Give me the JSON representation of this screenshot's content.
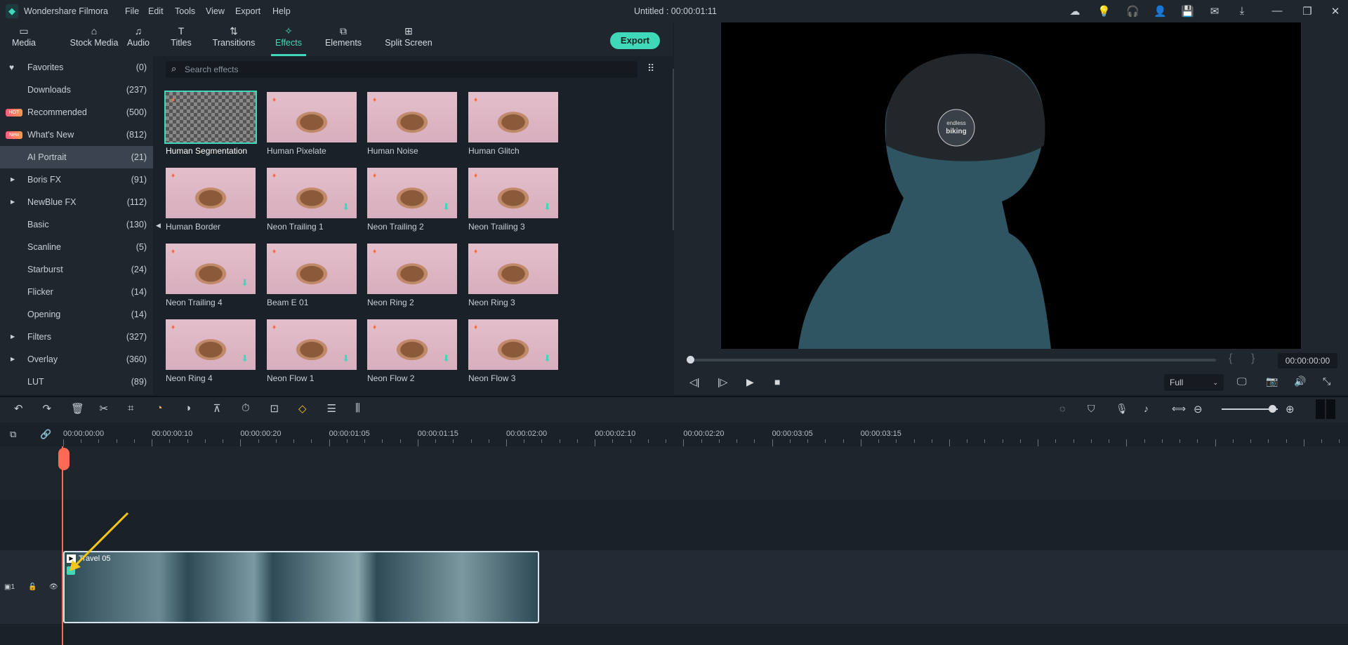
{
  "app": {
    "name": "Wondershare Filmora",
    "title": "Untitled : 00:00:01:11"
  },
  "menu": [
    "File",
    "Edit",
    "Tools",
    "View",
    "Export",
    "Help"
  ],
  "title_icons": [
    "cloud-icon",
    "bulb-icon",
    "headset-icon",
    "account-icon",
    "save-icon",
    "mail-icon",
    "download-icon",
    "minimize-icon",
    "restore-icon",
    "close-icon"
  ],
  "tabs": [
    {
      "label": "Media",
      "icon": "folder-icon"
    },
    {
      "label": "Stock Media",
      "icon": "stock-icon"
    },
    {
      "label": "Audio",
      "icon": "music-icon"
    },
    {
      "label": "Titles",
      "icon": "text-icon"
    },
    {
      "label": "Transitions",
      "icon": "transition-icon"
    },
    {
      "label": "Effects",
      "icon": "effects-icon",
      "active": true
    },
    {
      "label": "Elements",
      "icon": "elements-icon"
    },
    {
      "label": "Split Screen",
      "icon": "split-screen-icon"
    }
  ],
  "export_label": "Export",
  "sidebar": [
    {
      "label": "Favorites",
      "count": "(0)",
      "icon": "heart"
    },
    {
      "label": "Downloads",
      "count": "(237)"
    },
    {
      "label": "Recommended",
      "count": "(500)",
      "badge": "HOT"
    },
    {
      "label": "What's New",
      "count": "(812)",
      "badge": "New"
    },
    {
      "label": "AI Portrait",
      "count": "(21)",
      "selected": true
    },
    {
      "label": "Boris FX",
      "count": "(91)",
      "expandable": true
    },
    {
      "label": "NewBlue FX",
      "count": "(112)",
      "expandable": true
    },
    {
      "label": "Basic",
      "count": "(130)"
    },
    {
      "label": "Scanline",
      "count": "(5)"
    },
    {
      "label": "Starburst",
      "count": "(24)"
    },
    {
      "label": "Flicker",
      "count": "(14)"
    },
    {
      "label": "Opening",
      "count": "(14)"
    },
    {
      "label": "Filters",
      "count": "(327)",
      "expandable": true
    },
    {
      "label": "Overlay",
      "count": "(360)",
      "expandable": true
    },
    {
      "label": "LUT",
      "count": "(89)"
    }
  ],
  "search": {
    "placeholder": "Search effects"
  },
  "effects": [
    {
      "name": "Human Segmentation",
      "selected": true
    },
    {
      "name": "Human Pixelate"
    },
    {
      "name": "Human Noise"
    },
    {
      "name": "Human Glitch"
    },
    {
      "name": "Human Border"
    },
    {
      "name": "Neon Trailing 1",
      "download": true
    },
    {
      "name": "Neon Trailing 2",
      "download": true
    },
    {
      "name": "Neon Trailing 3",
      "download": true
    },
    {
      "name": "Neon Trailing 4",
      "download": true
    },
    {
      "name": "Beam E 01"
    },
    {
      "name": "Neon Ring 2"
    },
    {
      "name": "Neon Ring 3"
    },
    {
      "name": "Neon Ring 4",
      "download": true
    },
    {
      "name": "Neon Flow 1",
      "download": true
    },
    {
      "name": "Neon Flow 2",
      "download": true
    },
    {
      "name": "Neon Flow 3",
      "download": true
    }
  ],
  "preview": {
    "timecode": "00:00:00:00",
    "quality": "Full",
    "progress": 0,
    "helmet_text": [
      "endless",
      "biking"
    ]
  },
  "timeline": {
    "ruler": [
      "00:00:00:00",
      "00:00:00:10",
      "00:00:00:20",
      "00:00:01:05",
      "00:00:01:15",
      "00:00:02:00",
      "00:00:02:10",
      "00:00:02:20",
      "00:00:03:05",
      "00:00:03:15"
    ],
    "clip_name": "Travel 05",
    "track_label": "1",
    "zoom_level": 0.9
  },
  "colors": {
    "accent": "#3fd8b8",
    "playhead": "#ff6a55",
    "arrow": "#f5c518"
  }
}
